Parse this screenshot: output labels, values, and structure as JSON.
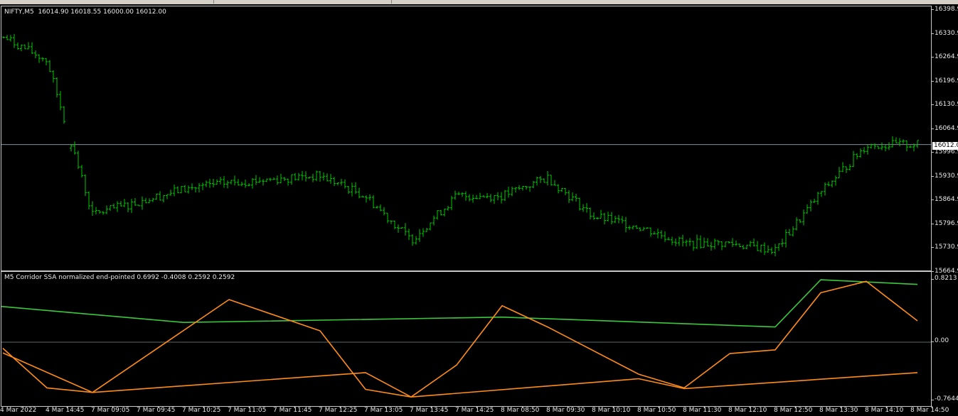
{
  "main_chart": {
    "title": "NIFTY,M5  16014.90 16018.55 16000.00 16012.00",
    "symbol": "NIFTY",
    "timeframe": "M5",
    "ohlc": {
      "open": 16014.9,
      "high": 16018.55,
      "low": 16000.0,
      "close": 16012.0
    },
    "current_price": "16012.0",
    "price_scale": [
      "16398.9",
      "16330.9",
      "16264.9",
      "16196.9",
      "16130.9",
      "16064.9",
      "15996.9",
      "15930.9",
      "15864.9",
      "15796.9",
      "15730.9",
      "15664.9"
    ],
    "bar_color": "#00c800",
    "price_line_color": "#8090a0"
  },
  "indicator": {
    "title": "M5 Corridor SSA normalized end-pointed 0.6992 -0.4008 0.2592 0.2592",
    "scale": [
      "0.8213",
      "0.00",
      "-0.7644"
    ],
    "colors": {
      "upper": "#3cc83c",
      "lower": "#ff8c1a"
    }
  },
  "time_axis": [
    "4 Mar 2022",
    "4 Mar 14:45",
    "7 Mar 09:05",
    "7 Mar 09:45",
    "7 Mar 10:25",
    "7 Mar 11:05",
    "7 Mar 11:45",
    "7 Mar 12:25",
    "7 Mar 13:05",
    "7 Mar 13:45",
    "7 Mar 14:25",
    "8 Mar 08:50",
    "8 Mar 09:30",
    "8 Mar 10:10",
    "8 Mar 10:50",
    "8 Mar 11:30",
    "8 Mar 12:10",
    "8 Mar 12:50",
    "8 Mar 13:30",
    "8 Mar 14:10",
    "8 Mar 14:50"
  ],
  "chart_data": [
    {
      "type": "ohlc",
      "title": "NIFTY,M5",
      "y_range": [
        15640,
        16420
      ],
      "x_range": [
        "4 Mar 2022",
        "8 Mar 14:50"
      ],
      "anchors": {
        "x_time": [
          "4 Mar 2022",
          "4 Mar 14:45",
          "7 Mar 09:05",
          "7 Mar 10:25",
          "7 Mar 11:05",
          "7 Mar 12:25",
          "7 Mar 13:05",
          "7 Mar 13:45",
          "7 Mar 14:25",
          "8 Mar 08:50",
          "8 Mar 09:30",
          "8 Mar 10:10",
          "8 Mar 10:50",
          "8 Mar 11:30",
          "8 Mar 12:10",
          "8 Mar 12:50",
          "8 Mar 13:30",
          "8 Mar 14:10",
          "8 Mar 14:50"
        ],
        "close": [
          16330,
          16260,
          15805,
          15880,
          15900,
          15920,
          15860,
          15730,
          15860,
          15860,
          15915,
          15800,
          15770,
          15720,
          15720,
          15700,
          15870,
          16010,
          16012
        ]
      },
      "last_close": 16012.0
    },
    {
      "type": "line",
      "title": "M5 Corridor SSA normalized end-pointed",
      "y_range": [
        -0.7644,
        0.8213
      ],
      "series": [
        {
          "name": "",
          "x": [
            "4 Mar 2022",
            "7 Mar 10:25",
            "8 Mar 08:50",
            "8 Mar 12:50",
            "8 Mar 13:30",
            "8 Mar 14:50"
          ],
          "values": [
            0.47,
            0.26,
            0.33,
            0.2,
            0.82,
            0.76
          ]
        },
        {
          "name": "",
          "x": [
            "4 Mar 2022",
            "4 Mar 14:45",
            "7 Mar 09:05",
            "7 Mar 11:05",
            "7 Mar 12:25",
            "7 Mar 13:05",
            "7 Mar 13:45",
            "7 Mar 14:25",
            "8 Mar 08:50",
            "8 Mar 09:30",
            "8 Mar 10:50",
            "8 Mar 11:30",
            "8 Mar 12:10",
            "8 Mar 12:50",
            "8 Mar 13:30",
            "8 Mar 14:10",
            "8 Mar 14:50"
          ],
          "values": [
            -0.08,
            -0.6,
            -0.66,
            0.56,
            0.15,
            -0.62,
            -0.72,
            -0.3,
            0.48,
            0.2,
            -0.42,
            -0.6,
            -0.15,
            -0.1,
            0.65,
            0.8,
            0.28
          ]
        },
        {
          "name": "",
          "x": [
            "4 Mar 2022",
            "7 Mar 09:05",
            "7 Mar 13:05",
            "7 Mar 13:45",
            "8 Mar 10:50",
            "8 Mar 11:30",
            "8 Mar 14:50"
          ],
          "values": [
            -0.14,
            -0.66,
            -0.4,
            -0.72,
            -0.48,
            -0.61,
            -0.4
          ]
        }
      ],
      "values": [
        0.6992,
        -0.4008,
        0.2592,
        0.2592
      ]
    }
  ]
}
